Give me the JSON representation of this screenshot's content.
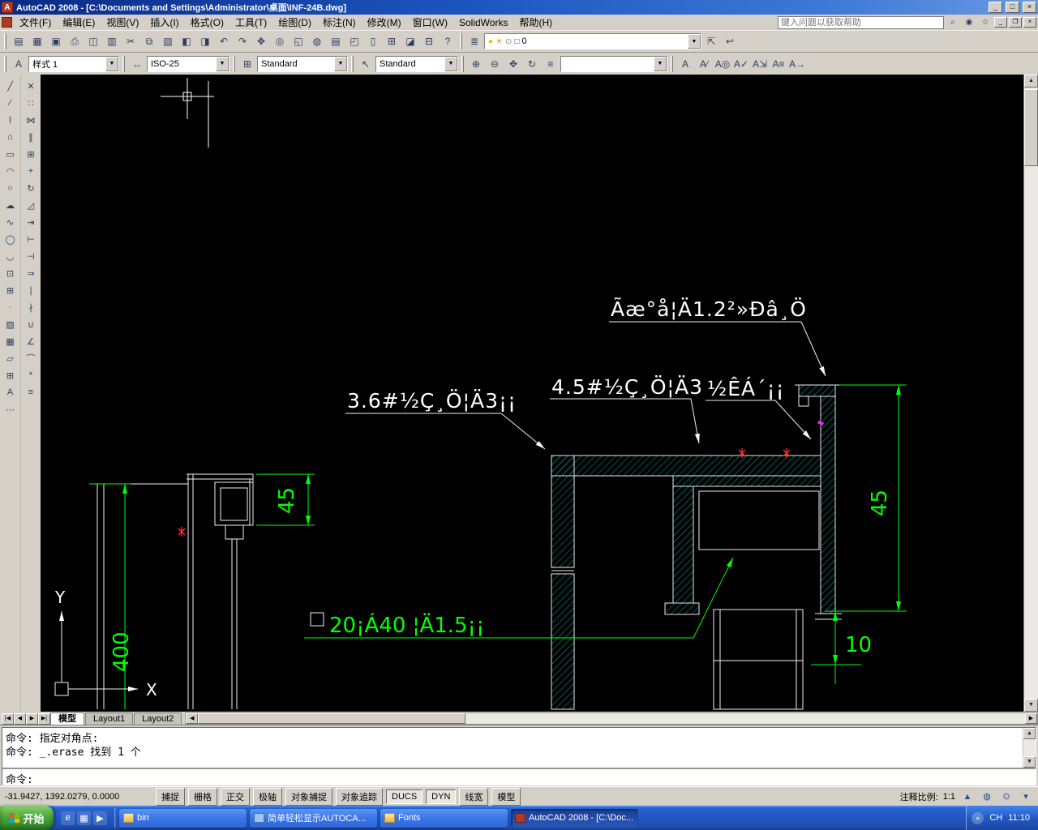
{
  "window": {
    "title": "AutoCAD 2008 - [C:\\Documents and Settings\\Administrator\\桌面\\INF-24B.dwg]",
    "controls": {
      "minimize": "_",
      "maximize": "□",
      "close": "×"
    }
  },
  "menu": {
    "items": [
      {
        "name": "menu-file",
        "label": "文件(F)"
      },
      {
        "name": "menu-edit",
        "label": "编辑(E)"
      },
      {
        "name": "menu-view",
        "label": "视图(V)"
      },
      {
        "name": "menu-insert",
        "label": "插入(I)"
      },
      {
        "name": "menu-format",
        "label": "格式(O)"
      },
      {
        "name": "menu-tools",
        "label": "工具(T)"
      },
      {
        "name": "menu-draw",
        "label": "绘图(D)"
      },
      {
        "name": "menu-dimension",
        "label": "标注(N)"
      },
      {
        "name": "menu-modify",
        "label": "修改(M)"
      },
      {
        "name": "menu-window",
        "label": "窗口(W)"
      },
      {
        "name": "menu-solidworks",
        "label": "SolidWorks"
      },
      {
        "name": "menu-help",
        "label": "帮助(H)"
      }
    ],
    "search_placeholder": "键入问题以获取帮助",
    "right_icons": [
      {
        "name": "search-icon",
        "glyph": "⌕"
      },
      {
        "name": "communication-center-icon",
        "glyph": "◉"
      },
      {
        "name": "favorites-icon",
        "glyph": "☆"
      }
    ],
    "mdi": {
      "minimize": "_",
      "restore": "❐",
      "close": "×"
    }
  },
  "toolbars": {
    "standard": [
      {
        "name": "qnew-icon",
        "glyph": "▤"
      },
      {
        "name": "open-icon",
        "glyph": "▦"
      },
      {
        "name": "save-icon",
        "glyph": "▣"
      },
      {
        "name": "plot-icon",
        "glyph": "⎙"
      },
      {
        "name": "plot-preview-icon",
        "glyph": "◫"
      },
      {
        "name": "publish-icon",
        "glyph": "▥"
      },
      {
        "name": "cut-icon",
        "glyph": "✂"
      },
      {
        "name": "copy-icon",
        "glyph": "⧉"
      },
      {
        "name": "paste-icon",
        "glyph": "▧"
      },
      {
        "name": "match-properties-icon",
        "glyph": "◧"
      },
      {
        "name": "block-editor-icon",
        "glyph": "◨"
      },
      {
        "name": "undo-icon",
        "glyph": "↶"
      },
      {
        "name": "redo-icon",
        "glyph": "↷"
      },
      {
        "name": "pan-icon",
        "glyph": "✥"
      },
      {
        "name": "zoom-realtime-icon",
        "glyph": "◎"
      },
      {
        "name": "zoom-window-icon",
        "glyph": "◱"
      },
      {
        "name": "zoom-previous-icon",
        "glyph": "◍"
      },
      {
        "name": "properties-icon",
        "glyph": "▤"
      },
      {
        "name": "designcenter-icon",
        "glyph": "◰"
      },
      {
        "name": "tool-palettes-icon",
        "glyph": "▯"
      },
      {
        "name": "sheet-set-manager-icon",
        "glyph": "⊞"
      },
      {
        "name": "markup-icon",
        "glyph": "◪"
      },
      {
        "name": "quickcalc-icon",
        "glyph": "⊟"
      },
      {
        "name": "help-icon",
        "glyph": "?"
      }
    ],
    "layers": {
      "properties_icon": {
        "name": "layer-properties-icon",
        "glyph": "≣"
      },
      "status_glyphs": [
        {
          "name": "layer-on-icon",
          "glyph": "●",
          "color": "#e0c018"
        },
        {
          "name": "layer-freeze-icon",
          "glyph": "☀",
          "color": "#e09a18"
        },
        {
          "name": "layer-lock-icon",
          "glyph": "⊙",
          "color": "#8a8a8a"
        },
        {
          "name": "layer-color-icon",
          "glyph": "□",
          "color": "#444444"
        }
      ],
      "current_layer": "0",
      "after_icons": [
        {
          "name": "make-layer-current-icon",
          "glyph": "⇱"
        },
        {
          "name": "layer-previous-icon",
          "glyph": "↩"
        }
      ]
    },
    "styles": {
      "text_style_icon": {
        "name": "text-style-icon",
        "glyph": "A"
      },
      "text_style": "样式 1",
      "dim_style_icon": {
        "name": "dim-style-icon",
        "glyph": "↔"
      },
      "dim_style": "ISO-25",
      "table_style_icon": {
        "name": "table-style-icon",
        "glyph": "⊞"
      },
      "table_style": "Standard",
      "mleader_style_icon": {
        "name": "multileader-style-icon",
        "glyph": "↖"
      },
      "mleader_style": "Standard",
      "annotation_scale_value": ""
    },
    "view_icons": [
      {
        "name": "zoom-in-icon",
        "glyph": "⊕"
      },
      {
        "name": "zoom-out-icon",
        "glyph": "⊖"
      },
      {
        "name": "pan-hand-icon",
        "glyph": "✥"
      },
      {
        "name": "orbit-icon",
        "glyph": "↻"
      },
      {
        "name": "view-settings-icon",
        "glyph": "≡"
      }
    ],
    "text_icons": [
      {
        "name": "mtext-icon",
        "glyph": "A"
      },
      {
        "name": "edit-text-icon",
        "glyph": "A∕"
      },
      {
        "name": "find-text-icon",
        "glyph": "A◎"
      },
      {
        "name": "spell-check-icon",
        "glyph": "A✓"
      },
      {
        "name": "text-scale-icon",
        "glyph": "A⇲"
      },
      {
        "name": "text-justify-icon",
        "glyph": "A≡"
      },
      {
        "name": "text-convert-icon",
        "glyph": "A→"
      }
    ]
  },
  "left_toolbar": {
    "draw": [
      {
        "name": "line-icon",
        "glyph": "╱"
      },
      {
        "name": "construction-line-icon",
        "glyph": "⁄"
      },
      {
        "name": "polyline-icon",
        "glyph": "⌇"
      },
      {
        "name": "polygon-icon",
        "glyph": "⌂"
      },
      {
        "name": "rectangle-icon",
        "glyph": "▭"
      },
      {
        "name": "arc-icon",
        "glyph": "◠"
      },
      {
        "name": "circle-icon",
        "glyph": "○"
      },
      {
        "name": "revcloud-icon",
        "glyph": "☁"
      },
      {
        "name": "spline-icon",
        "glyph": "∿"
      },
      {
        "name": "ellipse-icon",
        "glyph": "◯"
      },
      {
        "name": "ellipse-arc-icon",
        "glyph": "◡"
      },
      {
        "name": "insert-block-icon",
        "glyph": "⊡"
      },
      {
        "name": "make-block-icon",
        "glyph": "⊞"
      },
      {
        "name": "point-icon",
        "glyph": "·"
      },
      {
        "name": "hatch-icon",
        "glyph": "▨"
      },
      {
        "name": "gradient-icon",
        "glyph": "▦"
      },
      {
        "name": "region-icon",
        "glyph": "▱"
      },
      {
        "name": "table-icon",
        "glyph": "⊞"
      },
      {
        "name": "mtext-draw-icon",
        "glyph": "A"
      },
      {
        "name": "divide-icon",
        "glyph": "⋯"
      }
    ],
    "modify": [
      {
        "name": "erase-icon",
        "glyph": "✕"
      },
      {
        "name": "copy-object-icon",
        "glyph": "∷"
      },
      {
        "name": "mirror-icon",
        "glyph": "⋈"
      },
      {
        "name": "offset-icon",
        "glyph": "∥"
      },
      {
        "name": "array-icon",
        "glyph": "⊞"
      },
      {
        "name": "move-icon",
        "glyph": "+"
      },
      {
        "name": "rotate-icon",
        "glyph": "↻"
      },
      {
        "name": "scale-icon",
        "glyph": "◿"
      },
      {
        "name": "stretch-icon",
        "glyph": "⇥"
      },
      {
        "name": "lengthen-icon",
        "glyph": "⊢"
      },
      {
        "name": "trim-icon",
        "glyph": "⊣"
      },
      {
        "name": "extend-icon",
        "glyph": "⇒"
      },
      {
        "name": "break-at-point-icon",
        "glyph": "∣"
      },
      {
        "name": "break-icon",
        "glyph": "∤"
      },
      {
        "name": "join-icon",
        "glyph": "∪"
      },
      {
        "name": "chamfer-icon",
        "glyph": "∠"
      },
      {
        "name": "fillet-icon",
        "glyph": "⌒"
      },
      {
        "name": "explode-icon",
        "glyph": "*"
      },
      {
        "name": "align-icon",
        "glyph": "≡"
      }
    ]
  },
  "drawing": {
    "annotations": {
      "panel_label": "Ãæ°å¦Ä1.2²»Ðâ¸Ö",
      "angle36_label": "3.6#½Ç¸Ö¦Ä3¡¡",
      "angle45_label": "4.5#½Ç¸Ö¦Ä3",
      "hinge_label": "½ÊÁ´¡¡",
      "tube_label": "20¡Á40 ¦Ä1.5¡¡",
      "dim_45_left": "45",
      "dim_400": "400",
      "dim_45_right": "45",
      "dim_10": "10",
      "ucs_x": "X",
      "ucs_y": "Y"
    },
    "colors": {
      "geometry": "#f0f0f0",
      "hatch": "#00a8a8",
      "dimension": "#00ff00",
      "marker_red": "#ff3030",
      "marker_magenta": "#ff45ff",
      "background": "#000000"
    }
  },
  "tabs": {
    "nav": [
      "|◀",
      "◀",
      "▶",
      "▶|"
    ],
    "items": [
      {
        "name": "tab-model",
        "label": "模型",
        "active": true
      },
      {
        "name": "tab-layout1",
        "label": "Layout1"
      },
      {
        "name": "tab-layout2",
        "label": "Layout2"
      }
    ]
  },
  "command": {
    "history": [
      "命令: 指定对角点:",
      "命令: _.erase 找到 1 个"
    ],
    "prompt": "命令:"
  },
  "status": {
    "coords": "-31.9427, 1392.0279, 0.0000",
    "buttons": [
      {
        "name": "snap-button",
        "label": "捕捉"
      },
      {
        "name": "grid-button",
        "label": "栅格"
      },
      {
        "name": "ortho-button",
        "label": "正交"
      },
      {
        "name": "polar-button",
        "label": "极轴"
      },
      {
        "name": "osnap-button",
        "label": "对象捕捉"
      },
      {
        "name": "otrack-button",
        "label": "对象追踪"
      },
      {
        "name": "ducs-button",
        "label": "DUCS",
        "pressed": true
      },
      {
        "name": "dyn-button",
        "label": "DYN",
        "pressed": true
      },
      {
        "name": "lineweight-button",
        "label": "线宽"
      },
      {
        "name": "model-button",
        "label": "模型"
      }
    ],
    "annotation_scale_label": "注释比例:",
    "annotation_scale": "1:1",
    "right_icons": [
      {
        "name": "annotation-auto-icon",
        "glyph": "▲"
      },
      {
        "name": "annotation-visibility-icon",
        "glyph": "◍"
      },
      {
        "name": "toolbar-lock-icon",
        "glyph": "⊙"
      },
      {
        "name": "status-menu-arrow-icon",
        "glyph": "▾"
      }
    ]
  },
  "taskbar": {
    "start": "开始",
    "quick_launch": [
      {
        "name": "quicklaunch-ie-icon",
        "glyph": "e"
      },
      {
        "name": "quicklaunch-desktop-icon",
        "glyph": "▦"
      },
      {
        "name": "quicklaunch-player-icon",
        "glyph": "▶"
      }
    ],
    "tasks": [
      {
        "name": "task-bin",
        "icon": "folder",
        "label": "bin"
      },
      {
        "name": "task-autocad-tip",
        "icon": "app",
        "label": "简单轻松显示AUTOCA..."
      },
      {
        "name": "task-fonts",
        "icon": "folder",
        "label": "Fonts"
      },
      {
        "name": "task-autocad",
        "icon": "acad",
        "label": "AutoCAD 2008 - [C:\\Doc...",
        "active": true
      }
    ],
    "tray": {
      "chevron": "«",
      "ime": "CH",
      "time": "11:10"
    }
  }
}
